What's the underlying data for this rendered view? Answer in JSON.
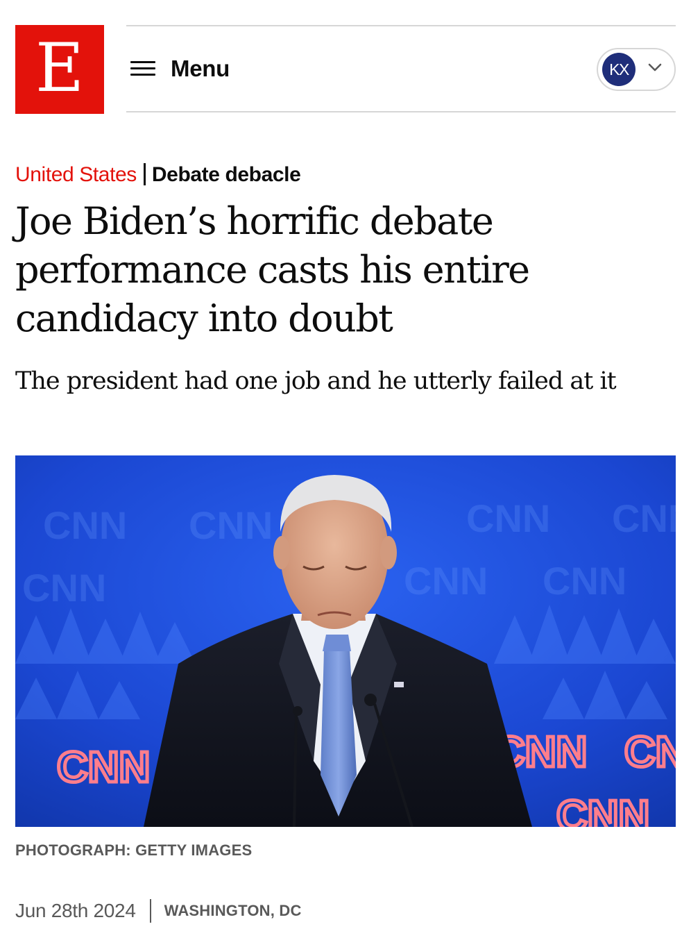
{
  "header": {
    "logo_letter": "E",
    "menu_label": "Menu",
    "account_initials": "KX",
    "brand_color": "#e3120b",
    "avatar_color": "#1f2e7a"
  },
  "article": {
    "section": "United States",
    "rubric": "Debate debacle",
    "headline": "Joe Biden’s horrific debate performance casts his entire candidacy into doubt",
    "subheadline": "The president had one job and he utterly failed at it",
    "photo": {
      "caption": "PHOTOGRAPH: GETTY IMAGES",
      "backdrop_text": "CNN"
    },
    "date": "Jun 28th 2024",
    "location": "WASHINGTON, DC"
  }
}
